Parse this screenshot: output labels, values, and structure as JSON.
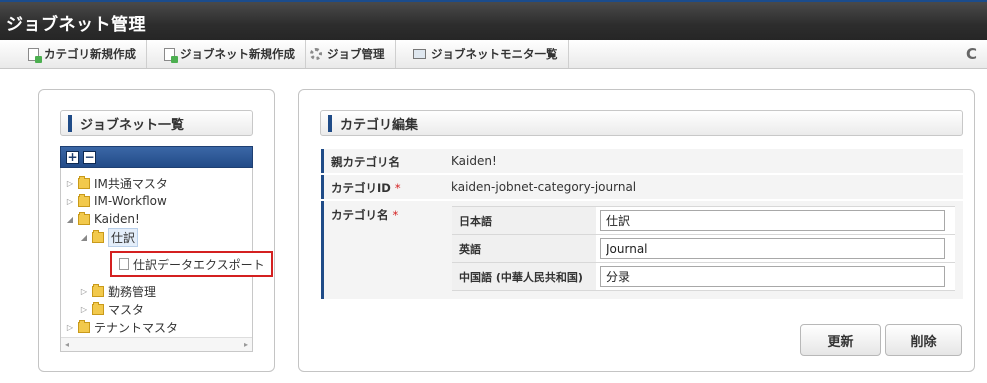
{
  "window": {
    "title": "ジョブネット管理"
  },
  "toolbar": {
    "items": [
      {
        "label": "カテゴリ新規作成",
        "icon": "new-document-icon"
      },
      {
        "label": "ジョブネット新規作成",
        "icon": "new-document-icon"
      },
      {
        "label": "ジョブ管理",
        "icon": "gear-icon"
      },
      {
        "label": "ジョブネットモニタ一覧",
        "icon": "monitor-icon"
      }
    ],
    "refresh_glyph": "C"
  },
  "left_panel": {
    "title": "ジョブネット一覧",
    "expand_all": "+",
    "collapse_all": "−",
    "tree": [
      {
        "label": "IM共通マスタ",
        "toggle": "▷",
        "depth": 0
      },
      {
        "label": "IM-Workflow",
        "toggle": "▷",
        "depth": 0
      },
      {
        "label": "Kaiden!",
        "toggle": "◢",
        "depth": 0
      },
      {
        "label": "仕訳",
        "toggle": "◢",
        "depth": 1,
        "selected": true
      },
      {
        "label": "仕訳データエクスポート",
        "toggle": "",
        "depth": 2,
        "highlighted": true
      },
      {
        "label": "勤務管理",
        "toggle": "▷",
        "depth": 1
      },
      {
        "label": "マスタ",
        "toggle": "▷",
        "depth": 1
      },
      {
        "label": "テナントマスタ",
        "toggle": "▷",
        "depth": 0
      }
    ],
    "scroll_left": "◂",
    "scroll_right": "▸"
  },
  "right_panel": {
    "title": "カテゴリ編集",
    "fields": {
      "parent_label": "親カテゴリ名",
      "parent_value": "Kaiden!",
      "id_label": "カテゴリID",
      "id_value": "kaiden-jobnet-category-journal",
      "name_label": "カテゴリ名",
      "required_mark": "*"
    },
    "names": [
      {
        "lang": "日本語",
        "value": "仕訳"
      },
      {
        "lang": "英語",
        "value": "Journal"
      },
      {
        "lang": "中国語 (中華人民共和国)",
        "value": "分录"
      }
    ],
    "update_button": "更新",
    "delete_button": "削除"
  },
  "colors": {
    "accent_blue": "#1f4b87",
    "highlight_red": "#d42020",
    "titlebar_dark": "#2d2d2d"
  }
}
